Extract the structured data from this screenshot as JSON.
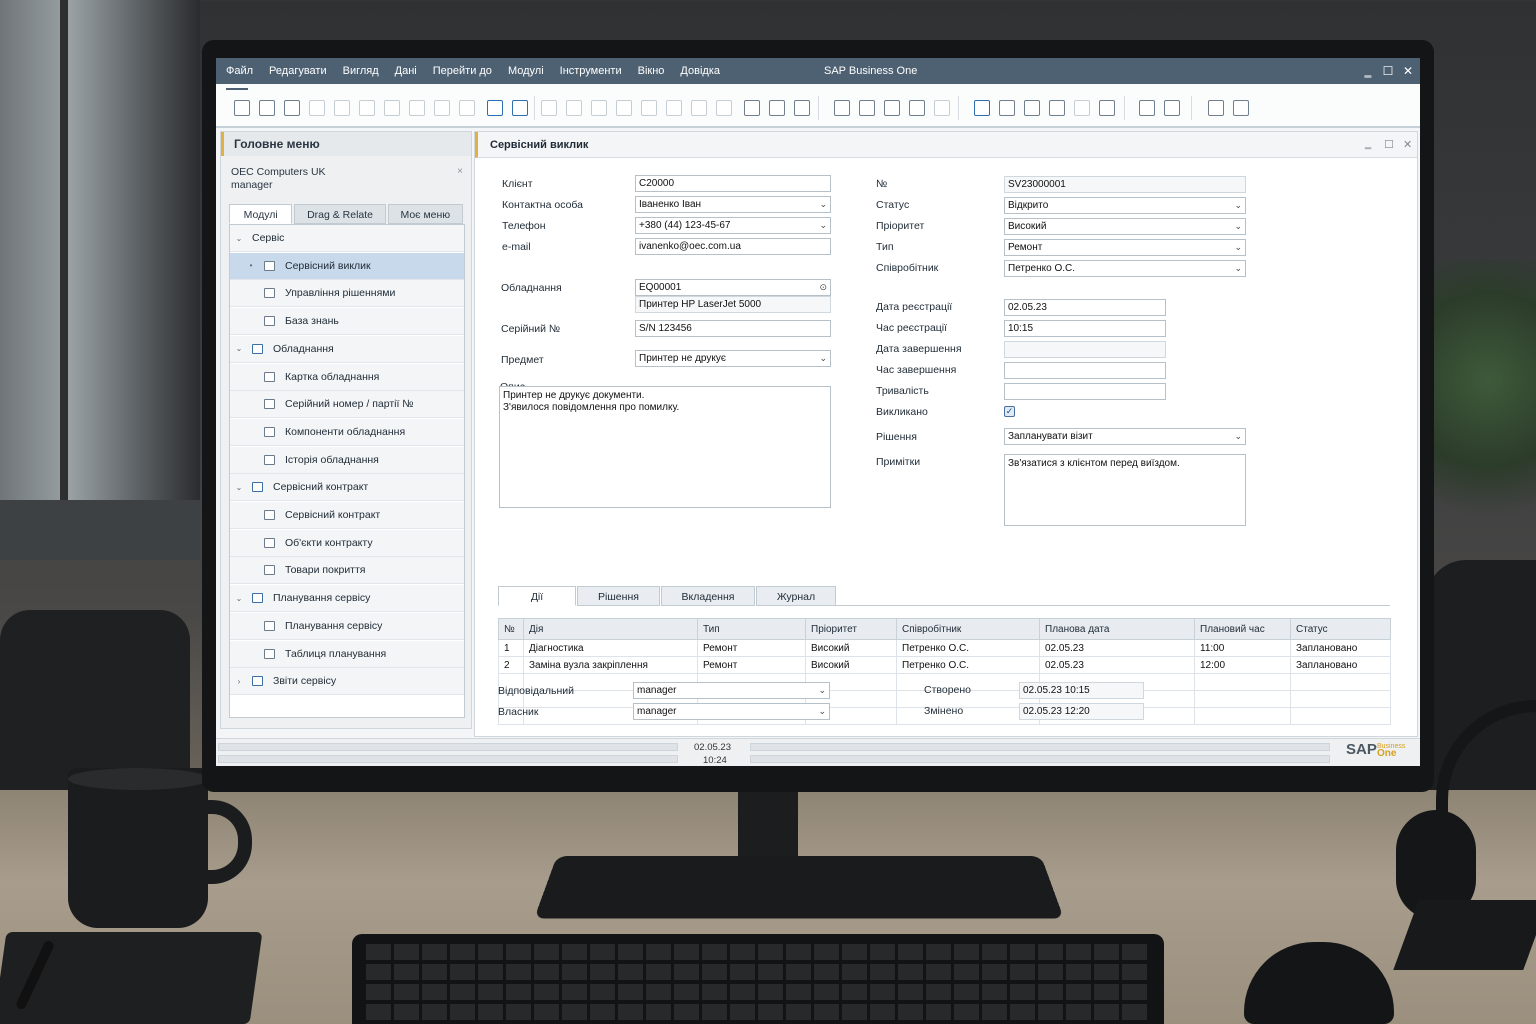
{
  "window": {
    "app_title": "SAP Business One",
    "minimize": "‗",
    "maximize": "☐",
    "close": "✕"
  },
  "menu": [
    "Файл",
    "Редагувати",
    "Вигляд",
    "Дані",
    "Перейти до",
    "Модулі",
    "Інструменти",
    "Вікно",
    "Довідка"
  ],
  "left_panel": {
    "title": "Головне меню",
    "company": "OEC Computers UK",
    "user": "manager",
    "close": "×",
    "tabs": [
      "Модулі",
      "Drag & Relate",
      "Моє меню"
    ],
    "tree": [
      {
        "label": "Сервіс",
        "level": 0,
        "expanded": true
      },
      {
        "label": "Сервісний виклик",
        "level": 1,
        "selected": true
      },
      {
        "label": "Управління рішеннями",
        "level": 1
      },
      {
        "label": "База знань",
        "level": 1
      },
      {
        "label": "Обладнання",
        "level": 0,
        "expanded": true
      },
      {
        "label": "Картка обладнання",
        "level": 1
      },
      {
        "label": "Серійний номер / партії №",
        "level": 1
      },
      {
        "label": "Компоненти обладнання",
        "level": 1
      },
      {
        "label": "Історія обладнання",
        "level": 1
      },
      {
        "label": "Сервісний контракт",
        "level": 0,
        "expanded": true
      },
      {
        "label": "Сервісний контракт",
        "level": 1
      },
      {
        "label": "Об'єкти контракту",
        "level": 1
      },
      {
        "label": "Товари покриття",
        "level": 1
      },
      {
        "label": "Планування сервісу",
        "level": 0,
        "expanded": true
      },
      {
        "label": "Планування сервісу",
        "level": 1
      },
      {
        "label": "Таблиця планування",
        "level": 1
      },
      {
        "label": "Звіти сервісу",
        "level": 0,
        "expanded": false
      }
    ]
  },
  "form": {
    "title": "Сервісний виклик",
    "left": {
      "client_label": "Клієнт",
      "client": "C20000",
      "contact_label": "Контактна особа",
      "contact": "Іваненко Іван",
      "phone_label": "Телефон",
      "phone": "+380 (44) 123-45-67",
      "email_label": "e-mail",
      "email": "ivanenko@oec.com.ua",
      "equipment_label": "Обладнання",
      "equipment": "EQ00001",
      "equipment_name": "Принтер HP LaserJet 5000",
      "serial_label": "Серійний №",
      "serial": "S/N 123456",
      "subject_label": "Предмет",
      "subject": "Принтер не друкує",
      "description_label": "Опис",
      "description_line1": "Принтер не друкує документи.",
      "description_line2": "З'явилося повідомлення про помилку."
    },
    "right": {
      "number_label": "№",
      "number": "SV23000001",
      "status_label": "Статус",
      "status": "Відкрито",
      "priority_label": "Пріоритет",
      "priority": "Високий",
      "type_label": "Тип",
      "type": "Ремонт",
      "employee_label": "Співробітник",
      "employee": "Петренко О.С.",
      "reg_date_label": "Дата реєстрації",
      "reg_date": "02.05.23",
      "reg_time_label": "Час реєстрації",
      "reg_time": "10:15",
      "end_date_label": "Дата завершення",
      "end_date": "",
      "end_time_label": "Час завершення",
      "end_time": "",
      "duration_label": "Тривалість",
      "duration": "",
      "called_label": "Викликано",
      "called": true,
      "solution_label": "Рішення",
      "solution": "Запланувати візит",
      "notes_label": "Примітки",
      "notes": "Зв'язатися з клієнтом перед виїздом."
    },
    "tabs": [
      "Дії",
      "Рішення",
      "Вкладення",
      "Журнал"
    ],
    "grid": {
      "columns": [
        "№",
        "Дія",
        "Тип",
        "Пріоритет",
        "Співробітник",
        "Планова дата",
        "Плановий час",
        "Статус"
      ],
      "rows": [
        [
          "1",
          "Діагностика",
          "Ремонт",
          "Високий",
          "Петренко О.С.",
          "02.05.23",
          "11:00",
          "Заплановано"
        ],
        [
          "2",
          "Заміна вузла закріплення",
          "Ремонт",
          "Високий",
          "Петренко О.С.",
          "02.05.23",
          "12:00",
          "Заплановано"
        ]
      ]
    },
    "footer": {
      "responsible_label": "Відповідальний",
      "responsible": "manager",
      "owner_label": "Власник",
      "owner": "manager",
      "created_label": "Створено",
      "created": "02.05.23    10:15",
      "changed_label": "Змінено",
      "changed": "02.05.23    12:20"
    }
  },
  "statusbar": {
    "date": "02.05.23",
    "time": "10:24"
  },
  "logo": {
    "text": "SAP",
    "sub1": "Business",
    "sub2": "One"
  },
  "colors": {
    "menubar": "#4e6173",
    "accent": "#e0b040",
    "selection": "#c9d9ec"
  }
}
